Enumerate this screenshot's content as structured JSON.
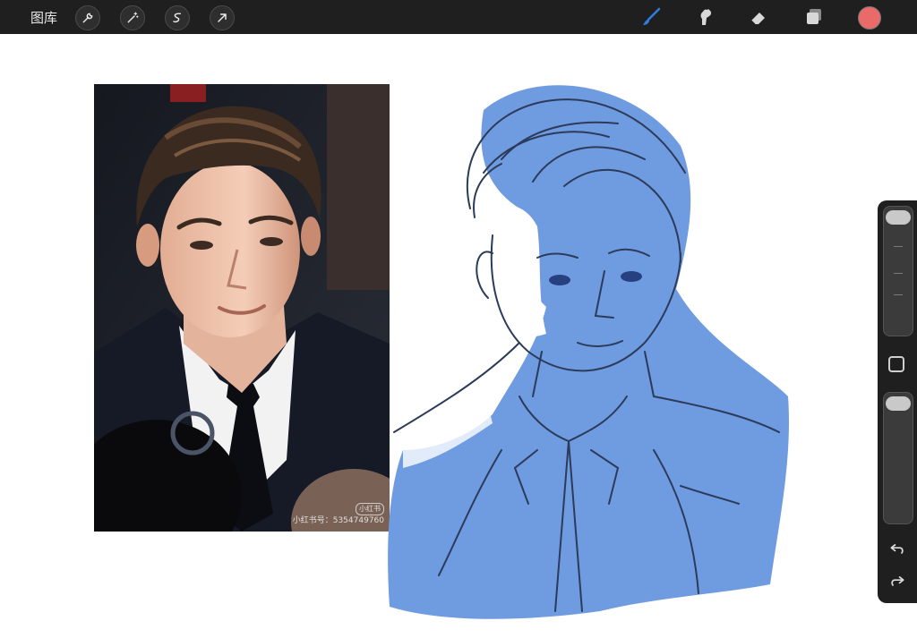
{
  "topbar": {
    "gallery_label": "图库",
    "left_tools": [
      "wrench-icon",
      "magic-wand-icon",
      "selection-icon",
      "transform-arrow-icon"
    ],
    "right_tools": [
      "brush-icon",
      "smudge-icon",
      "eraser-icon",
      "layers-icon"
    ],
    "brush_active_color": "#2f7de0",
    "current_color": "#ea6a6a"
  },
  "reference_photo": {
    "watermark_badge": "小红书",
    "watermark_id": "小红书号：5354749760"
  },
  "sidebar": {
    "undo_icon": "undo-icon",
    "redo_icon": "redo-icon",
    "modify_button": "square-icon"
  },
  "colors": {
    "sketch_fill": "#6f9be0",
    "sketch_line": "#2c3b5a",
    "ui_dark": "#1f1f1f"
  }
}
